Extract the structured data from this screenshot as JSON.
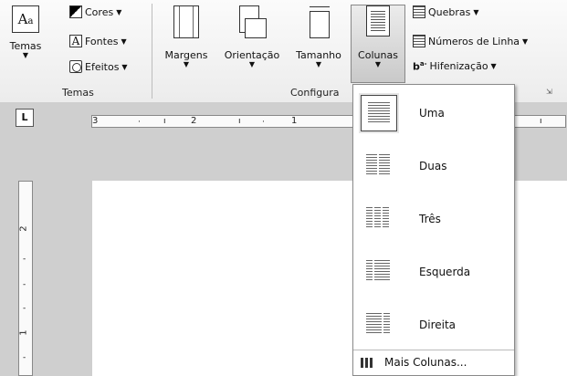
{
  "ribbon": {
    "temas_group": {
      "label": "Temas",
      "temas_button": "Temas",
      "cores": "Cores",
      "fontes": "Fontes",
      "efeitos": "Efeitos"
    },
    "config_group": {
      "label": "Configura",
      "margens": "Margens",
      "orientacao": "Orientação",
      "tamanho": "Tamanho",
      "colunas": "Colunas",
      "quebras": "Quebras",
      "numeros_linha": "Números de Linha",
      "hifenizacao": "Hifenização"
    }
  },
  "ruler": {
    "h_numbers": [
      "3",
      "2",
      "1"
    ],
    "v_numbers": [
      "2",
      "1"
    ]
  },
  "columns_menu": {
    "items": [
      {
        "label": "Uma",
        "selected": true
      },
      {
        "label": "Duas",
        "selected": false
      },
      {
        "label": "Três",
        "selected": false
      },
      {
        "label": "Esquerda",
        "selected": false
      },
      {
        "label": "Direita",
        "selected": false
      }
    ],
    "more_label": "Mais Colunas..."
  }
}
